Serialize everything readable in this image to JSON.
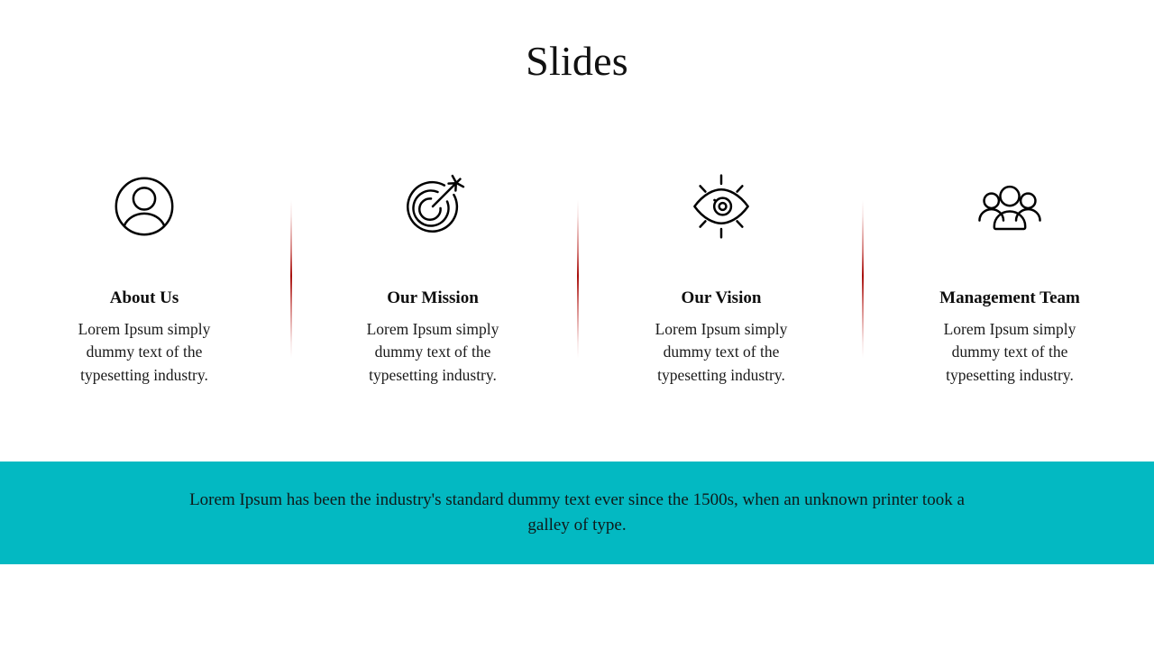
{
  "slide": {
    "title": "Slides",
    "background_color": "#ffffff"
  },
  "theme": {
    "banner_color": "#03b9c2",
    "divider_color": "#a80f0c",
    "icon_color": "#000000",
    "heading_color": "#0d0d0d",
    "body_color": "#1a1a1a"
  },
  "columns": [
    {
      "icon": "user-circle-icon",
      "heading": "About Us",
      "body": "Lorem Ipsum simply dummy text of the typesetting industry."
    },
    {
      "icon": "target-arrow-icon",
      "heading": "Our Mission",
      "body": "Lorem Ipsum simply dummy text of the typesetting industry."
    },
    {
      "icon": "eye-vision-icon",
      "heading": "Our Vision",
      "body": "Lorem Ipsum simply dummy text of the typesetting industry."
    },
    {
      "icon": "people-group-icon",
      "heading": "Management Team",
      "body": "Lorem Ipsum simply dummy text of the typesetting industry."
    }
  ],
  "dividers": [
    {
      "name": "divider-1"
    },
    {
      "name": "divider-2"
    },
    {
      "name": "divider-3"
    }
  ],
  "banner": {
    "text": "Lorem Ipsum has been the industry's standard dummy text ever since the 1500s, when an unknown printer took a galley of type."
  }
}
